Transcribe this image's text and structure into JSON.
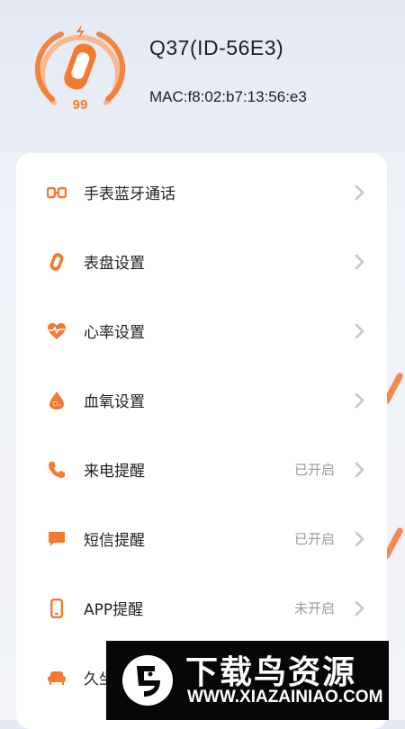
{
  "device": {
    "battery_level": "99",
    "name": "Q37(ID-56E3)",
    "mac": "MAC:f8:02:b7:13:56:e3"
  },
  "colors": {
    "accent": "#f47a2f",
    "chevron": "#c9c9c9"
  },
  "settings": [
    {
      "label": "手表蓝牙通话",
      "status": "",
      "icon": "bluetooth-call-icon"
    },
    {
      "label": "表盘设置",
      "status": "",
      "icon": "watch-face-icon"
    },
    {
      "label": "心率设置",
      "status": "",
      "icon": "heart-rate-icon"
    },
    {
      "label": "血氧设置",
      "status": "",
      "icon": "blood-oxygen-icon"
    },
    {
      "label": "来电提醒",
      "status": "已开启",
      "icon": "phone-icon"
    },
    {
      "label": "短信提醒",
      "status": "已开启",
      "icon": "message-icon"
    },
    {
      "label": "APP提醒",
      "status": "未开启",
      "icon": "app-phone-icon"
    },
    {
      "label": "久坐",
      "status": "",
      "icon": "sofa-icon"
    }
  ],
  "watermark": {
    "title": "下载鸟资源",
    "url": "WWW.XIAZAINIAO.COM"
  }
}
